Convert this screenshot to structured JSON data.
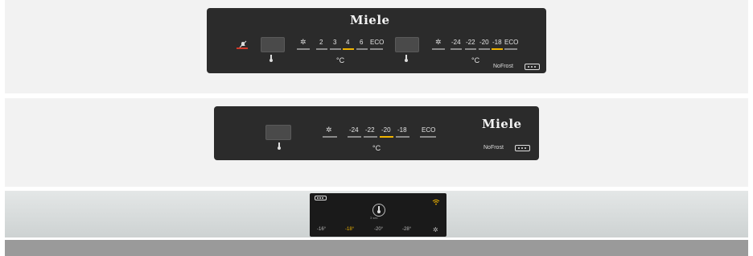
{
  "panel1": {
    "brand": "Miele",
    "fridge_temps": [
      "2",
      "3",
      "4",
      "6",
      "ECO"
    ],
    "fridge_unit": "°C",
    "freezer_temps": [
      "-24",
      "-22",
      "-20",
      "-18",
      "ECO"
    ],
    "freezer_unit": "°C",
    "nofrost_label": "NoFrost"
  },
  "panel2": {
    "brand": "Miele",
    "freezer_temps": [
      "-24",
      "-22",
      "-20",
      "-18",
      "ECO"
    ],
    "unit": "°C",
    "nofrost_label": "NoFrost"
  },
  "panel3": {
    "temps": [
      "-16°",
      "-18°",
      "-20°",
      "-28°"
    ],
    "selected": "-18°",
    "small_text": "3 sec"
  },
  "colors": {
    "selected": "#f0b400",
    "alarm_off": "#d23a2a",
    "panel": "#2b2b2b"
  }
}
